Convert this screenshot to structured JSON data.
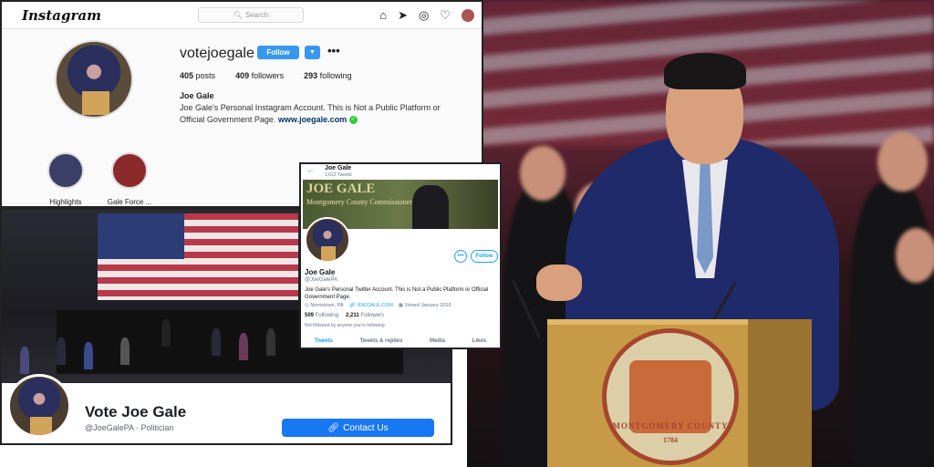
{
  "instagram": {
    "logo": "Instagram",
    "search_placeholder": "Search",
    "username": "votejoegale",
    "follow_label": "Follow",
    "more": "•••",
    "stats": {
      "posts_count": "405",
      "posts_label": "posts",
      "followers_count": "409",
      "followers_label": "followers",
      "following_count": "293",
      "following_label": "following"
    },
    "name": "Joe Gale",
    "bio": "Joe Gale's Personal Instagram Account. This is Not a Public Platform or Official Government Page.",
    "link": "www.joegale.com",
    "highlights": [
      {
        "label": "Highlights"
      },
      {
        "label": "Gale Force ..."
      }
    ]
  },
  "facebook": {
    "page_name": "Vote Joe Gale",
    "handle": "@JoeGalePA",
    "category": "Politician",
    "contact_label": "Contact Us"
  },
  "twitter": {
    "back": "←",
    "name_top": "Joe Gale",
    "tweets_top": "1,612 Tweets",
    "banner_title": "JOE GALE",
    "banner_subtitle": "Montgomery County Commissioner",
    "follow_label": "Follow",
    "name": "Joe Gale",
    "handle": "@JoeGalePA",
    "bio": "Joe Gale's Personal Twitter Account. This is Not a Public Platform or Official Government Page.",
    "location": "Norristown, PA",
    "link": "JOEGALE.COM",
    "joined": "Joined January 2016",
    "following_count": "509",
    "following_label": "Following",
    "followers_count": "2,211",
    "followers_label": "Followers",
    "not_followed": "Not followed by anyone you're following",
    "tabs": [
      "Tweets",
      "Tweets & replies",
      "Media",
      "Likes"
    ]
  },
  "seal": {
    "text": "MONTGOMERY COUNTY",
    "year": "1784"
  },
  "colors": {
    "instagram_blue": "#3897f0",
    "facebook_blue": "#1877f2",
    "twitter_blue": "#1da1f2"
  }
}
